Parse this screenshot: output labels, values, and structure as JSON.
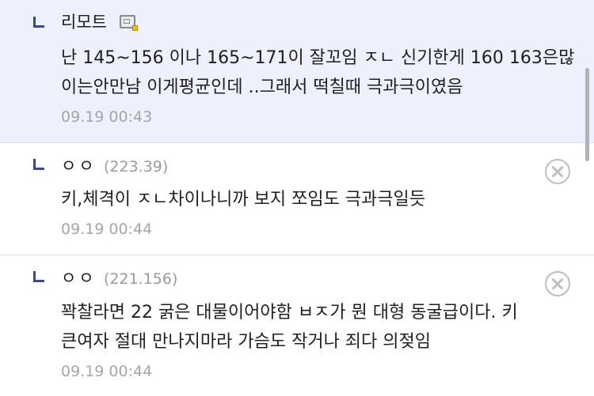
{
  "comments": [
    {
      "author": "리모트",
      "member_icon": "member-badge-icon",
      "lines": [
        "난 145~156 이나 165~171이 잘꼬임 ㅈㄴ 신기한게 160 163은많",
        "이는안만남 이게평균인데 ..그래서 떡칠때 극과극이였음"
      ],
      "time": "09.19 00:43",
      "highlight_color": "#eef1fd"
    },
    {
      "author": "ㅇㅇ",
      "ip": "(223.39)",
      "lines": [
        "키,체격이 ㅈㄴ차이나니까 보지 쪼임도 극과극일듯"
      ],
      "time": "09.19 00:44"
    },
    {
      "author": "ㅇㅇ",
      "ip": "(221.156)",
      "lines": [
        "꽉찰라면 22 굵은 대물이어야함 ㅂㅈ가 뭔 대형 동굴급이다. 키",
        "큰여자 절대 만나지마라 가슴도 작거나 죄다 의젖임"
      ],
      "time": "09.19 00:44"
    }
  ],
  "colors": {
    "reply_mark": "#3b4a8c",
    "timestamp": "#a6a6a6",
    "ip": "#9a9a9a"
  }
}
